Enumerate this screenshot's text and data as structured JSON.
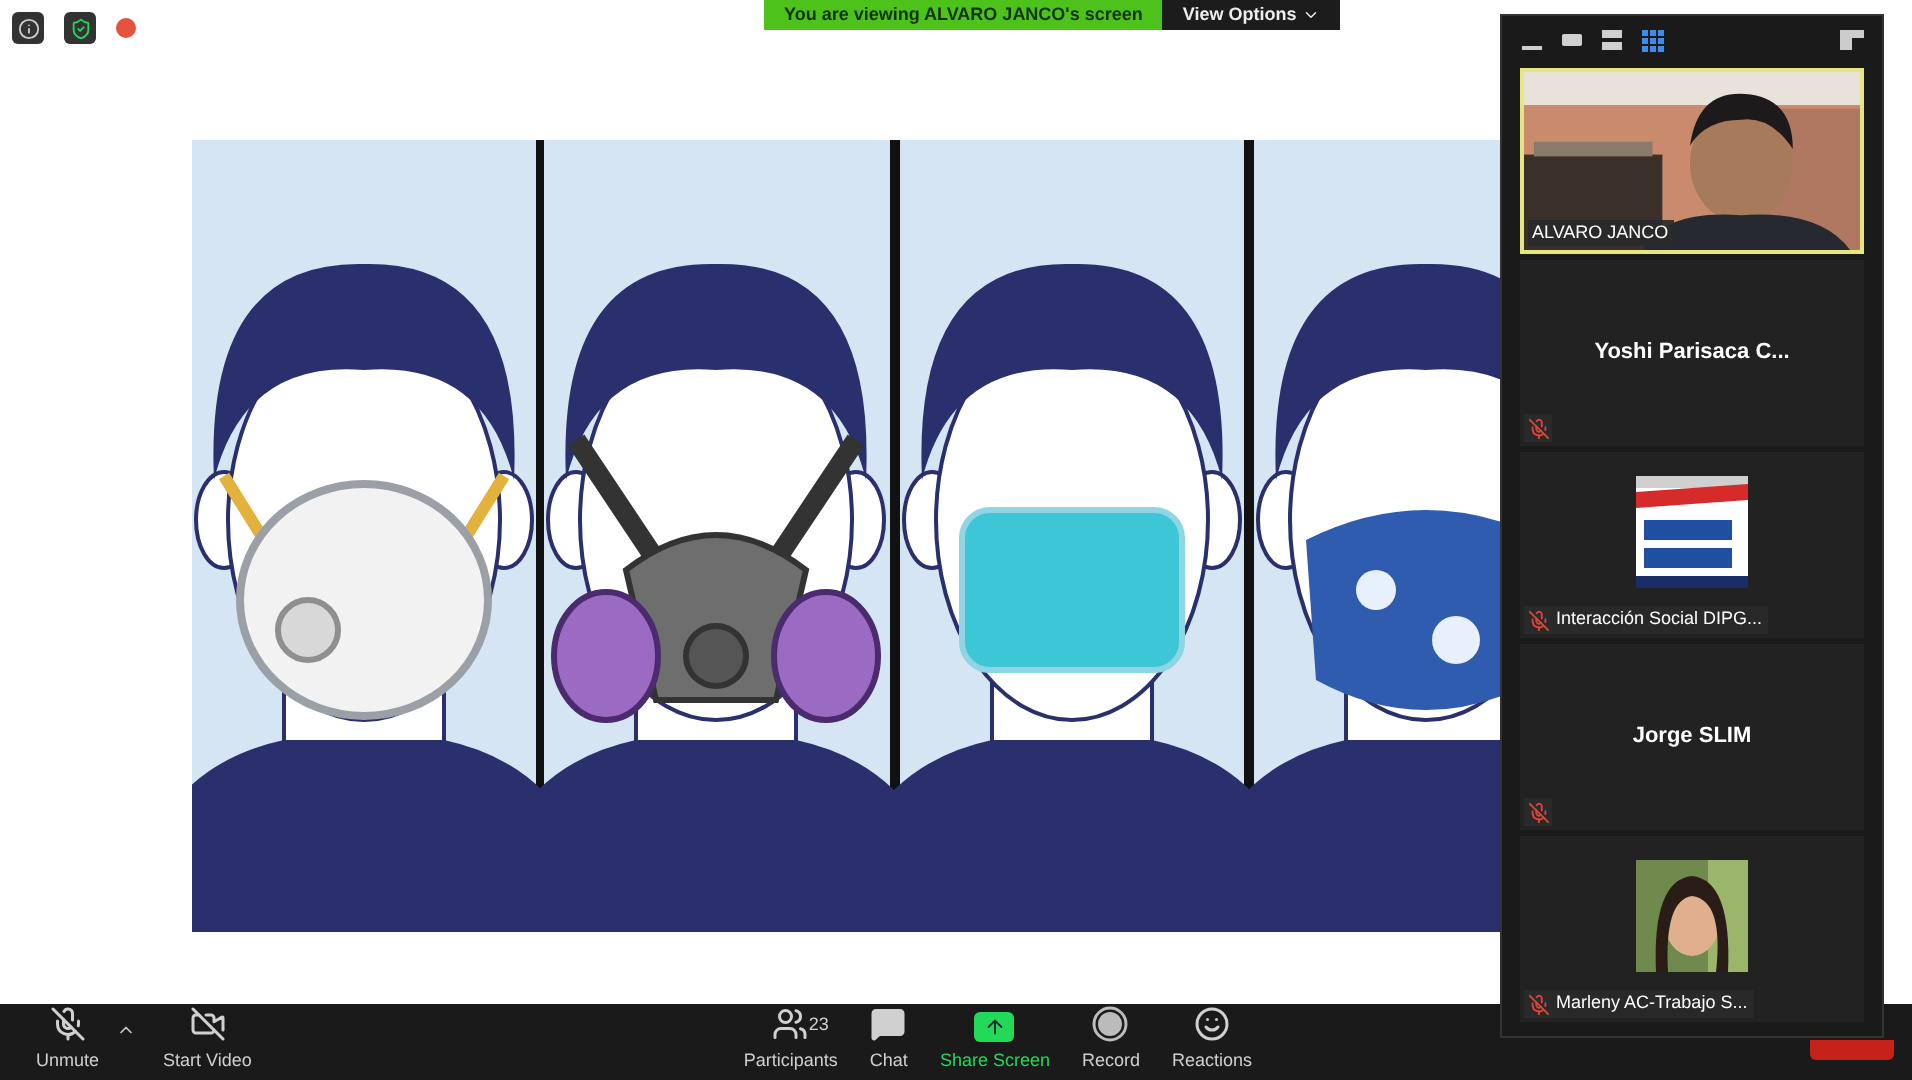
{
  "banner": {
    "text": "You are viewing ALVARO JANCO's screen",
    "view_options": "View Options"
  },
  "gallery": {
    "view_modes": [
      {
        "kind": "minimize",
        "selected": false
      },
      {
        "kind": "speaker",
        "selected": false
      },
      {
        "kind": "strip",
        "selected": false
      },
      {
        "kind": "grid",
        "selected": true
      }
    ],
    "tiles": [
      {
        "kind": "video",
        "name": "ALVARO JANCO",
        "active": true,
        "muted": false
      },
      {
        "kind": "name",
        "name": "Yoshi Parisaca C...",
        "active": false,
        "muted": true
      },
      {
        "kind": "logo",
        "name": "Interacción Social DIPG...",
        "active": false,
        "muted": true
      },
      {
        "kind": "name",
        "name": "Jorge SLIM",
        "active": false,
        "muted": true
      },
      {
        "name": "Marleny AC-Trabajo S...",
        "active": false,
        "muted": true
      }
    ]
  },
  "toolbar": [
    {
      "kind": "unmute",
      "label": "Unmute"
    },
    {
      "kind": "video",
      "label": "Start Video"
    },
    {
      "kind": "participants",
      "label": "Participants",
      "count": "23"
    },
    {
      "kind": "chat",
      "label": "Chat"
    },
    {
      "kind": "share",
      "label": "Share Screen"
    },
    {
      "kind": "record",
      "label": "Record"
    },
    {
      "kind": "reactions",
      "label": "Reactions"
    }
  ]
}
